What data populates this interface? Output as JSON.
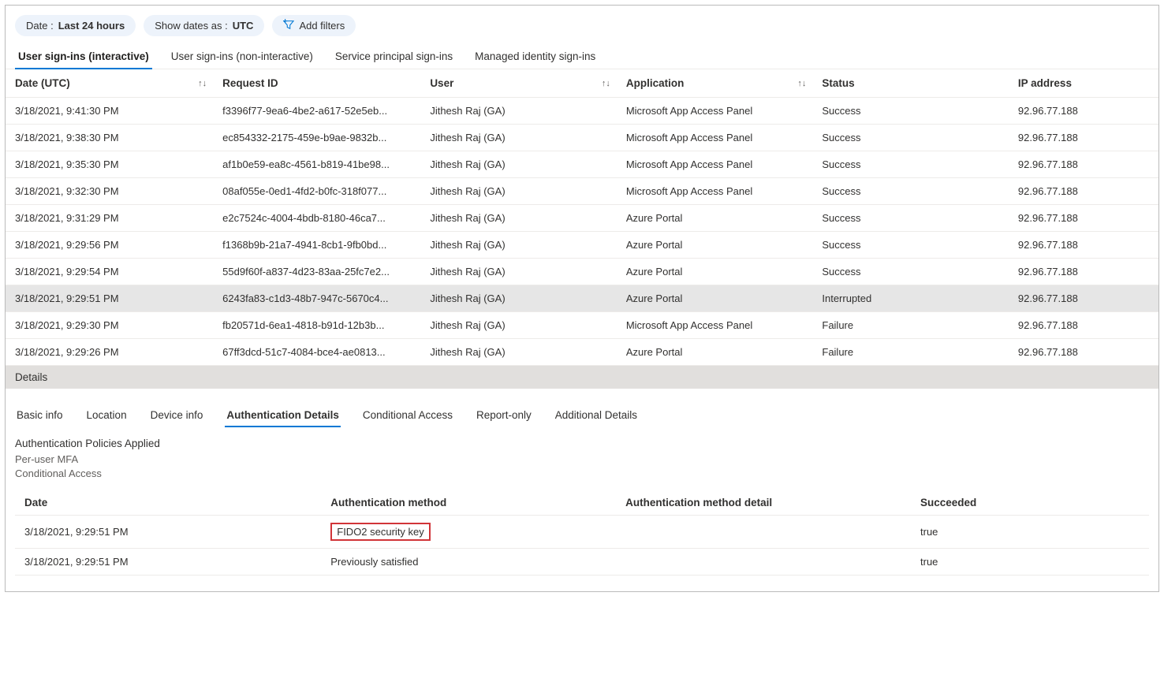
{
  "filters": {
    "date_label": "Date : ",
    "date_value": "Last 24 hours",
    "show_dates_label": "Show dates as : ",
    "show_dates_value": "UTC",
    "add_filters": "Add filters"
  },
  "tabs": {
    "t0": "User sign-ins (interactive)",
    "t1": "User sign-ins (non-interactive)",
    "t2": "Service principal sign-ins",
    "t3": "Managed identity sign-ins"
  },
  "columns": {
    "date": "Date (UTC)",
    "request_id": "Request ID",
    "user": "User",
    "application": "Application",
    "status": "Status",
    "ip": "IP address"
  },
  "rows": [
    {
      "date": "3/18/2021, 9:41:30 PM",
      "req": "f3396f77-9ea6-4be2-a617-52e5eb...",
      "user": "Jithesh Raj (GA)",
      "app": "Microsoft App Access Panel",
      "status": "Success",
      "ip": "92.96.77.188"
    },
    {
      "date": "3/18/2021, 9:38:30 PM",
      "req": "ec854332-2175-459e-b9ae-9832b...",
      "user": "Jithesh Raj (GA)",
      "app": "Microsoft App Access Panel",
      "status": "Success",
      "ip": "92.96.77.188"
    },
    {
      "date": "3/18/2021, 9:35:30 PM",
      "req": "af1b0e59-ea8c-4561-b819-41be98...",
      "user": "Jithesh Raj (GA)",
      "app": "Microsoft App Access Panel",
      "status": "Success",
      "ip": "92.96.77.188"
    },
    {
      "date": "3/18/2021, 9:32:30 PM",
      "req": "08af055e-0ed1-4fd2-b0fc-318f077...",
      "user": "Jithesh Raj (GA)",
      "app": "Microsoft App Access Panel",
      "status": "Success",
      "ip": "92.96.77.188"
    },
    {
      "date": "3/18/2021, 9:31:29 PM",
      "req": "e2c7524c-4004-4bdb-8180-46ca7...",
      "user": "Jithesh Raj (GA)",
      "app": "Azure Portal",
      "status": "Success",
      "ip": "92.96.77.188"
    },
    {
      "date": "3/18/2021, 9:29:56 PM",
      "req": "f1368b9b-21a7-4941-8cb1-9fb0bd...",
      "user": "Jithesh Raj (GA)",
      "app": "Azure Portal",
      "status": "Success",
      "ip": "92.96.77.188"
    },
    {
      "date": "3/18/2021, 9:29:54 PM",
      "req": "55d9f60f-a837-4d23-83aa-25fc7e2...",
      "user": "Jithesh Raj (GA)",
      "app": "Azure Portal",
      "status": "Success",
      "ip": "92.96.77.188"
    },
    {
      "date": "3/18/2021, 9:29:51 PM",
      "req": "6243fa83-c1d3-48b7-947c-5670c4...",
      "user": "Jithesh Raj (GA)",
      "app": "Azure Portal",
      "status": "Interrupted",
      "ip": "92.96.77.188"
    },
    {
      "date": "3/18/2021, 9:29:30 PM",
      "req": "fb20571d-6ea1-4818-b91d-12b3b...",
      "user": "Jithesh Raj (GA)",
      "app": "Microsoft App Access Panel",
      "status": "Failure",
      "ip": "92.96.77.188"
    },
    {
      "date": "3/18/2021, 9:29:26 PM",
      "req": "67ff3dcd-51c7-4084-bce4-ae0813...",
      "user": "Jithesh Raj (GA)",
      "app": "Azure Portal",
      "status": "Failure",
      "ip": "92.96.77.188"
    }
  ],
  "details_header": "Details",
  "detail_tabs": {
    "t0": "Basic info",
    "t1": "Location",
    "t2": "Device info",
    "t3": "Authentication Details",
    "t4": "Conditional Access",
    "t5": "Report-only",
    "t6": "Additional Details"
  },
  "auth_policies": {
    "label": "Authentication Policies Applied",
    "p0": "Per-user MFA",
    "p1": "Conditional Access"
  },
  "auth_columns": {
    "date": "Date",
    "method": "Authentication method",
    "detail": "Authentication method detail",
    "succeeded": "Succeeded"
  },
  "auth_rows": [
    {
      "date": "3/18/2021, 9:29:51 PM",
      "method": "FIDO2 security key",
      "detail": "",
      "succ": "true"
    },
    {
      "date": "3/18/2021, 9:29:51 PM",
      "method": "Previously satisfied",
      "detail": "",
      "succ": "true"
    }
  ],
  "selected_row_index": 7,
  "highlighted_auth_row_index": 0
}
